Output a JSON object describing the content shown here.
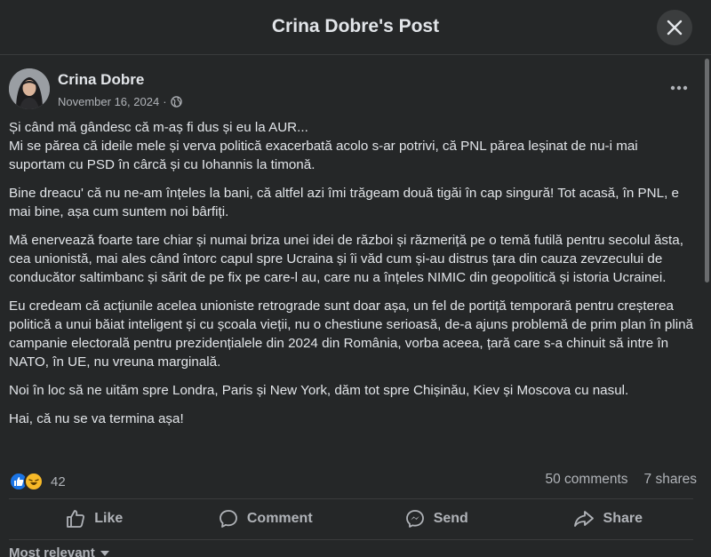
{
  "header": {
    "title": "Crina Dobre's Post",
    "close_icon": "close-icon"
  },
  "post": {
    "author": "Crina Dobre",
    "date": "November 16, 2024",
    "audience_icon": "globe-icon",
    "paragraphs": [
      "Și când mă gândesc că m-aș fi dus și eu la AUR...\nMi se părea că ideile mele și verva politică exacerbată acolo s-ar potrivi, că PNL părea leșinat de nu-i mai suportam cu PSD în cârcă și cu Iohannis la timonă.",
      "Bine dreacu' că nu ne-am înțeles la bani, că altfel azi îmi trăgeam două tigăi în cap singură! Tot acasă, în PNL, e mai bine, așa cum suntem noi bârfiți.",
      "Mă enervează foarte tare chiar și numai briza unei idei de război și răzmeriță pe o temă futilă pentru secolul ăsta, cea unionistă, mai ales când întorc capul spre Ucraina și îi văd cum și-au distrus țara din cauza zevzecului de conducător saltimbanc și sărit de pe fix pe care-l au, care nu a înțeles NIMIC din geopolitică și istoria Ucrainei.",
      "Eu credeam că acțiunile acelea unioniste retrograde sunt doar așa, un fel de portiță temporară pentru creșterea politică a unui băiat inteligent și cu școala vieții, nu o chestiune serioasă, de-a ajuns problemă de prim plan în plină campanie electorală pentru prezidențialele din 2024 din România, vorba aceea, țară care s-a chinuit să intre în NATO, în UE, nu vreuna marginală.",
      "Noi în loc să ne uităm spre Londra, Paris și New York, dăm tot spre Chișinău, Kiev și Moscova cu nasul.",
      "Hai, că nu se va termina așa!"
    ],
    "reactions": {
      "types": [
        "like",
        "haha"
      ],
      "count": "42"
    },
    "comments": "50 comments",
    "shares": "7 shares"
  },
  "actions": {
    "like": "Like",
    "comment": "Comment",
    "send": "Send",
    "share": "Share"
  },
  "sort": {
    "label": "Most relevant"
  },
  "colors": {
    "background": "#252728",
    "text": "#e2e5e9",
    "secondary": "#b0b3b8",
    "like_blue": "#1b74e4",
    "haha_yellow": "#f7b928"
  }
}
